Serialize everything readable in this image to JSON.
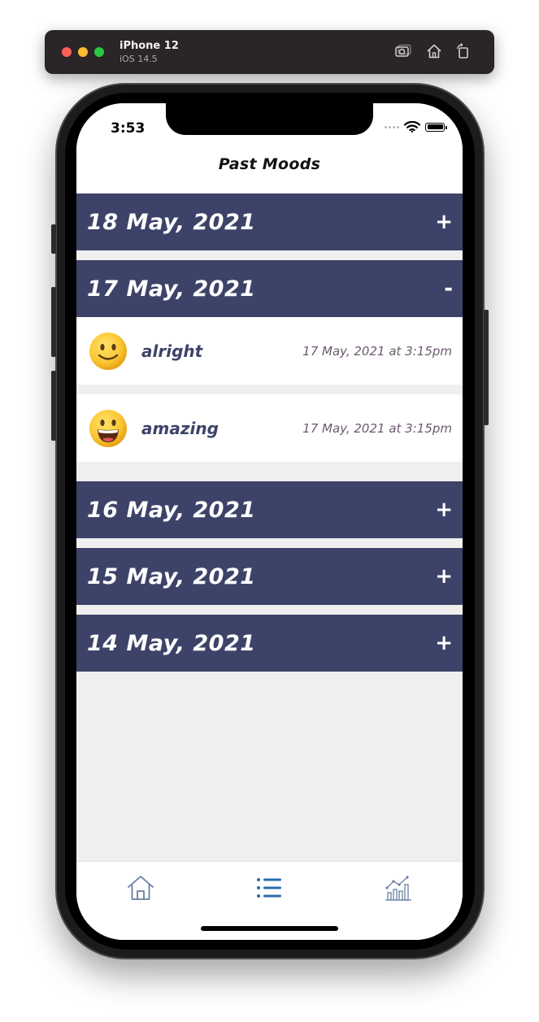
{
  "simulator": {
    "device_name": "iPhone 12",
    "os_version": "iOS 14.5"
  },
  "status_bar": {
    "time": "3:53"
  },
  "nav": {
    "title": "Past Moods"
  },
  "sections": [
    {
      "date": "18 May, 2021",
      "toggle": "+",
      "expanded": false,
      "entries": []
    },
    {
      "date": "17 May, 2021",
      "toggle": "-",
      "expanded": true,
      "entries": [
        {
          "emoji": "slightly-smiling-face",
          "label": "alright",
          "timestamp": "17 May, 2021 at 3:15pm"
        },
        {
          "emoji": "grinning-face-with-big-eyes",
          "label": "amazing",
          "timestamp": "17 May, 2021 at 3:15pm"
        }
      ]
    },
    {
      "date": "16 May, 2021",
      "toggle": "+",
      "expanded": false,
      "entries": []
    },
    {
      "date": "15 May, 2021",
      "toggle": "+",
      "expanded": false,
      "entries": []
    },
    {
      "date": "14 May, 2021",
      "toggle": "+",
      "expanded": false,
      "entries": []
    }
  ],
  "tab_bar": {
    "tabs": [
      {
        "icon": "home-icon",
        "active": false
      },
      {
        "icon": "list-icon",
        "active": true
      },
      {
        "icon": "chart-icon",
        "active": false
      }
    ]
  },
  "colors": {
    "section_header": "#3d4368",
    "background": "#efefef",
    "active_tab": "#2c6cb0",
    "inactive_tab": "#6a7fa0",
    "timestamp": "#6b5a6e"
  }
}
